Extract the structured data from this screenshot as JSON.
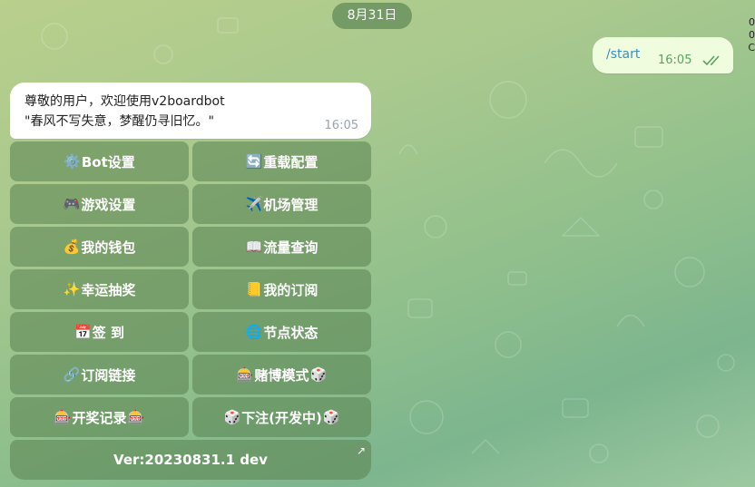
{
  "date_pill": "8月31日",
  "outgoing": {
    "text": "/start",
    "time": "16:05"
  },
  "incoming": {
    "line1": "尊敬的用户，欢迎使用v2boardbot",
    "line2": "\"春风不写失意，梦醒仍寻旧忆。\"",
    "time": "16:05"
  },
  "keyboard": {
    "rows": [
      [
        {
          "icon": "⚙️",
          "label": "Bot设置"
        },
        {
          "icon": "🔄",
          "label": "重载配置"
        }
      ],
      [
        {
          "icon": "🎮",
          "label": "游戏设置"
        },
        {
          "icon": "✈️",
          "label": "机场管理"
        }
      ],
      [
        {
          "icon": "💰",
          "label": "我的钱包"
        },
        {
          "icon": "📖",
          "label": "流量查询"
        }
      ],
      [
        {
          "icon": "✨",
          "label": "幸运抽奖"
        },
        {
          "icon": "📒",
          "label": "我的订阅"
        }
      ],
      [
        {
          "icon": "📅",
          "label": "签 到"
        },
        {
          "icon": "🌐",
          "label": "节点状态"
        }
      ],
      [
        {
          "icon": "🔗",
          "label": "订阅链接"
        },
        {
          "icon": "🎰",
          "label": "赌博模式",
          "icon2": "🎲"
        }
      ],
      [
        {
          "icon": "🎰",
          "label": "开奖记录",
          "icon2": "🎰"
        },
        {
          "icon": "🎲",
          "label": "下注(开发中)",
          "icon2": "🎲"
        }
      ]
    ],
    "full_row": {
      "label": "Ver:20230831.1 dev",
      "icon": "↗"
    }
  },
  "edge_glyphs": [
    "0",
    "0",
    "C"
  ]
}
